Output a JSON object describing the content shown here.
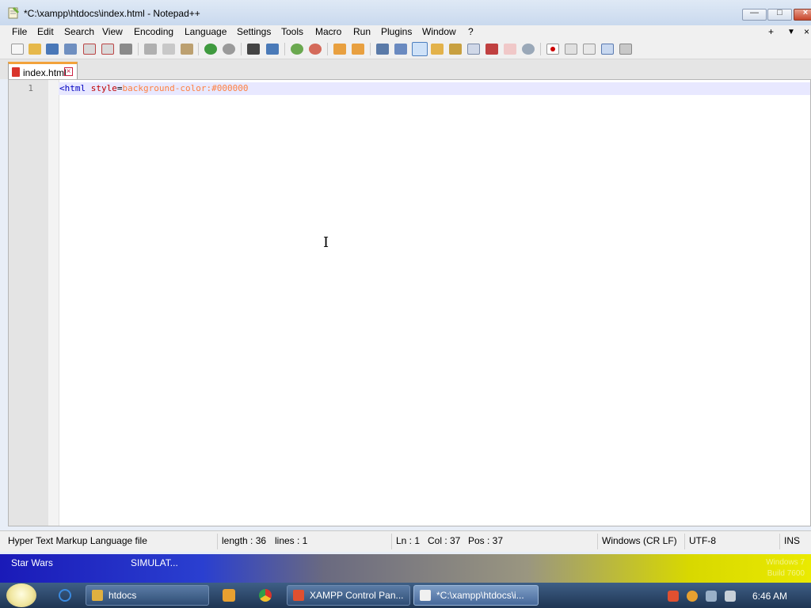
{
  "window": {
    "title": "*C:\\xampp\\htdocs\\index.html - Notepad++",
    "controls": {
      "minimize": "—",
      "maximize": "□",
      "close": "×"
    }
  },
  "menu": {
    "items": [
      "File",
      "Edit",
      "Search",
      "View",
      "Encoding",
      "Language",
      "Settings",
      "Tools",
      "Macro",
      "Run",
      "Plugins",
      "Window",
      "?"
    ],
    "right": [
      "+",
      "▼",
      "×"
    ]
  },
  "toolbar": {
    "icons": [
      "new-file",
      "open-file",
      "save",
      "save-all",
      "close",
      "close-all",
      "print",
      "cut",
      "copy",
      "paste",
      "undo",
      "redo",
      "find",
      "replace",
      "zoom-in",
      "zoom-out",
      "sync-vertical",
      "sync-horizontal",
      "word-wrap",
      "show-all-characters",
      "indent-guide",
      "user-defined-language",
      "document-map",
      "function-list",
      "folder-as-workspace",
      "monitoring",
      "record-macro",
      "stop-recording",
      "playback-macro",
      "run-macro-multiple",
      "save-macro"
    ]
  },
  "tabs": [
    {
      "label": "index.html"
    }
  ],
  "editor": {
    "line_numbers": [
      "1"
    ],
    "code": {
      "tag": "<html",
      "attr": "style",
      "eq": "=",
      "value": "background-color:#000000"
    }
  },
  "status": {
    "file_type": "Hyper Text Markup Language file",
    "length": "length : 36",
    "lines": "lines : 1",
    "ln": "Ln : 1",
    "col": "Col : 37",
    "pos": "Pos : 37",
    "eol": "Windows (CR LF)",
    "encoding": "UTF-8",
    "mode": "INS"
  },
  "desktop": {
    "labels": [
      "Star Wars",
      "SIMULAT..."
    ],
    "watermark_line1": "Windows 7",
    "watermark_line2": "Build 7600"
  },
  "taskbar": {
    "tasks": [
      {
        "label": "htdocs",
        "color": "#e0b040"
      },
      {
        "label": "XAMPP Control Pan...",
        "color": "#e05030"
      },
      {
        "label": "*C:\\xampp\\htdocs\\i...",
        "color": "#f0f0f0"
      }
    ],
    "clock": "6:46 AM"
  },
  "colors": {
    "tag": "#0000c0",
    "attribute": "#c00000",
    "value": "#ff8040",
    "tab_accent": "#f2a23a"
  }
}
